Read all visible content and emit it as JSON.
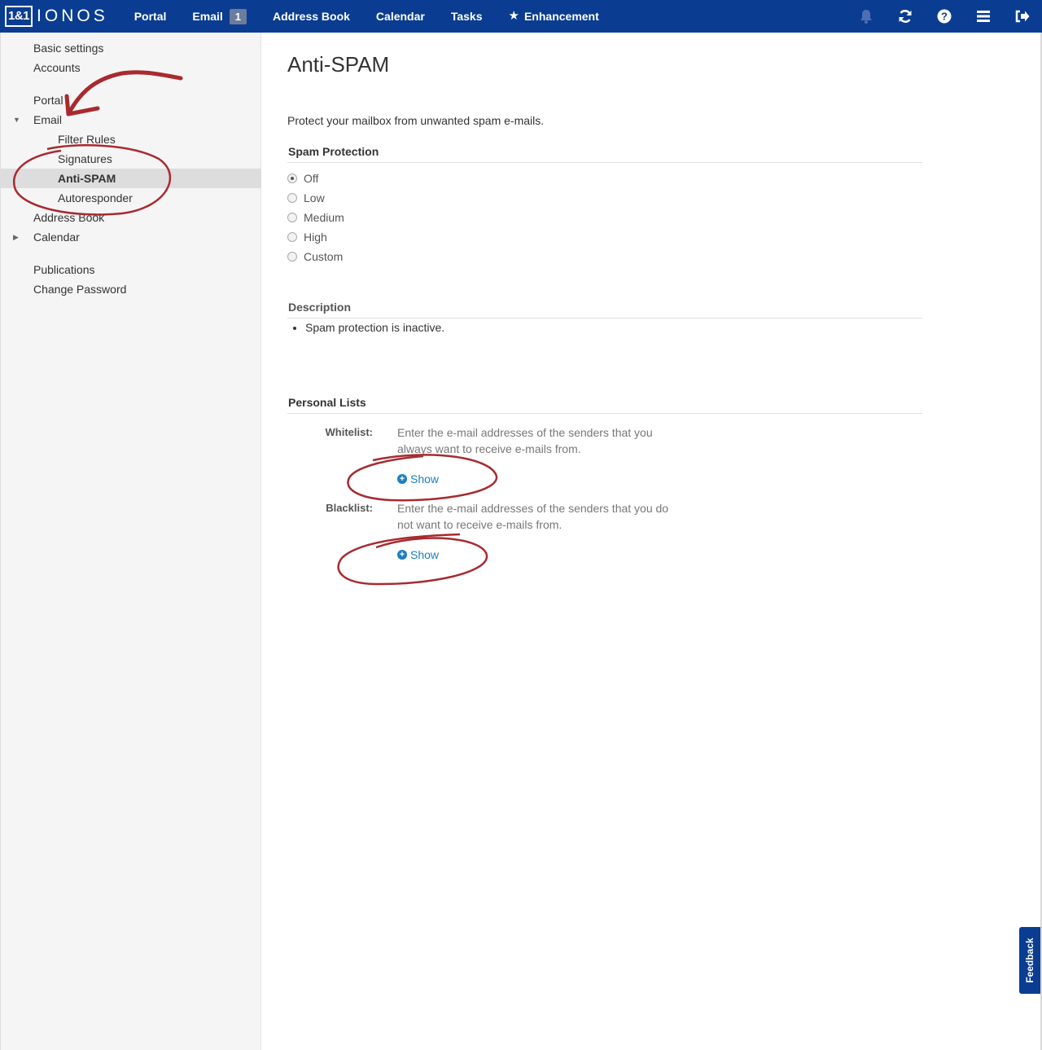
{
  "header": {
    "logo_box": "1&1",
    "logo_word": "IONOS",
    "nav": {
      "portal": "Portal",
      "email": "Email",
      "email_badge": "1",
      "address_book": "Address Book",
      "calendar": "Calendar",
      "tasks": "Tasks",
      "enhancement": "Enhancement"
    },
    "tools": [
      "bell-icon",
      "refresh-icon",
      "help-icon",
      "menu-icon",
      "logout-icon"
    ]
  },
  "sidebar": {
    "basic_settings": "Basic settings",
    "accounts": "Accounts",
    "portal": "Portal",
    "email": "Email",
    "filter_rules": "Filter Rules",
    "signatures": "Signatures",
    "anti_spam": "Anti-SPAM",
    "autoresponder": "Autoresponder",
    "address_book": "Address Book",
    "calendar": "Calendar",
    "publications": "Publications",
    "change_password": "Change Password"
  },
  "main": {
    "title": "Anti-SPAM",
    "intro": "Protect your mailbox from unwanted spam e-mails.",
    "spam_protection": {
      "heading": "Spam Protection",
      "options": [
        "Off",
        "Low",
        "Medium",
        "High",
        "Custom"
      ],
      "selected": "Off"
    },
    "description": {
      "heading": "Description",
      "items": [
        "Spam protection is inactive."
      ]
    },
    "personal_lists": {
      "heading": "Personal Lists",
      "whitelist_label": "Whitelist:",
      "whitelist_text": "Enter the e-mail addresses of the senders that you always want to receive e-mails from.",
      "blacklist_label": "Blacklist:",
      "blacklist_text": "Enter the e-mail addresses of the senders that you do not want to receive e-mails from.",
      "show_label": "Show"
    }
  },
  "feedback": "Feedback",
  "colors": {
    "topbar": "#0a3d91",
    "link": "#1a7fc0",
    "annotation": "#a82a2f"
  }
}
